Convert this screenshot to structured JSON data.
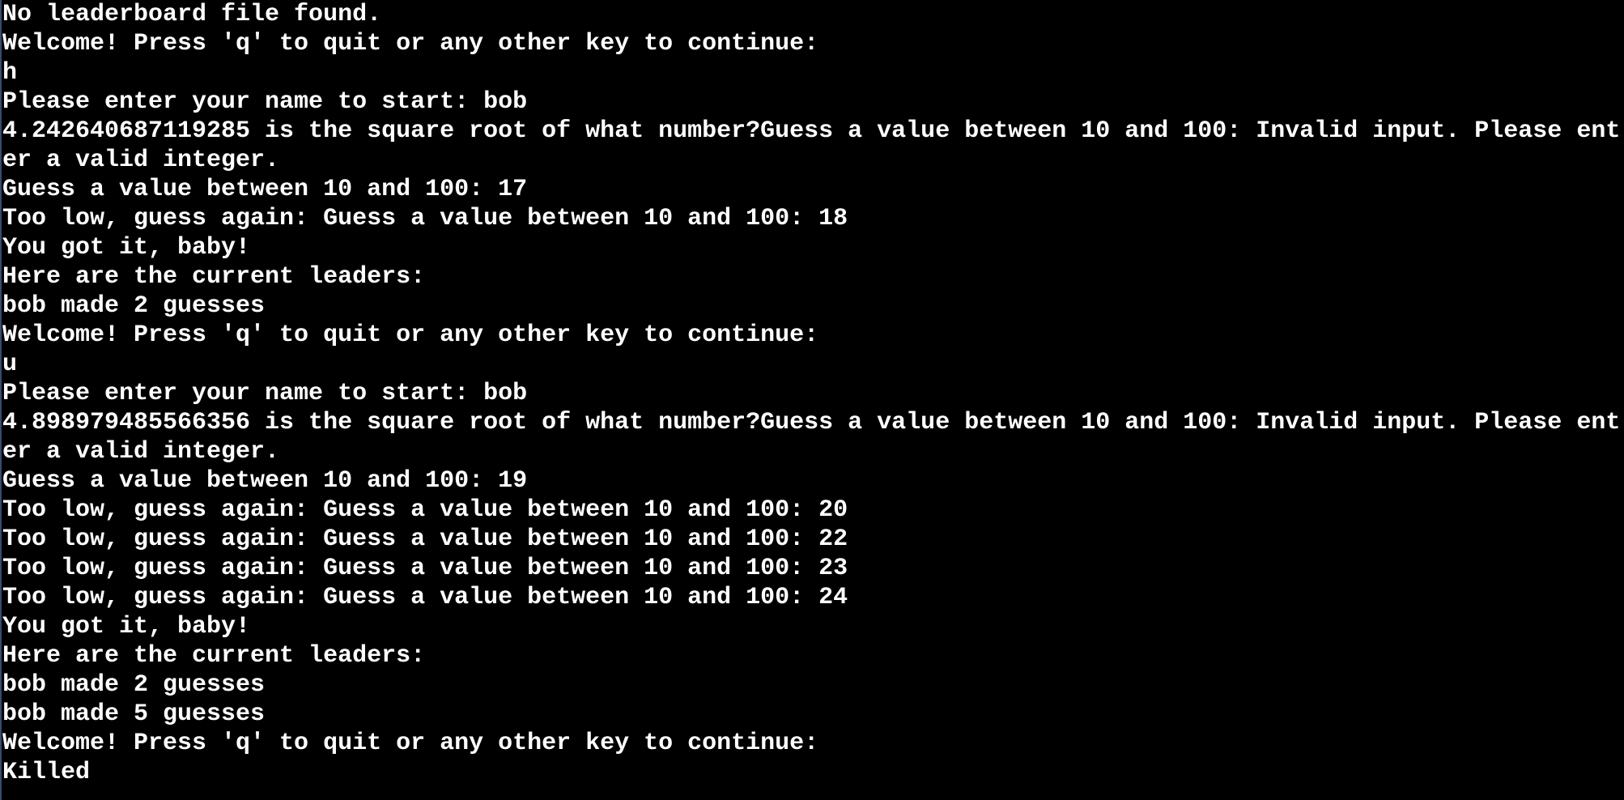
{
  "terminal": {
    "background": "#000000",
    "foreground": "#ffffff",
    "lines": [
      "No leaderboard file found.",
      "Welcome! Press 'q' to quit or any other key to continue:",
      "h",
      "Please enter your name to start: bob",
      "4.242640687119285 is the square root of what number?Guess a value between 10 and 100: Invalid input. Please ent",
      "er a valid integer.",
      "Guess a value between 10 and 100: 17",
      "Too low, guess again: Guess a value between 10 and 100: 18",
      "You got it, baby!",
      "Here are the current leaders:",
      "bob made 2 guesses",
      "Welcome! Press 'q' to quit or any other key to continue:",
      "u",
      "Please enter your name to start: bob",
      "4.898979485566356 is the square root of what number?Guess a value between 10 and 100: Invalid input. Please ent",
      "er a valid integer.",
      "Guess a value between 10 and 100: 19",
      "Too low, guess again: Guess a value between 10 and 100: 20",
      "Too low, guess again: Guess a value between 10 and 100: 22",
      "Too low, guess again: Guess a value between 10 and 100: 23",
      "Too low, guess again: Guess a value between 10 and 100: 24",
      "You got it, baby!",
      "Here are the current leaders:",
      "bob made 2 guesses",
      "bob made 5 guesses",
      "Welcome! Press 'q' to quit or any other key to continue:",
      "Killed"
    ]
  }
}
